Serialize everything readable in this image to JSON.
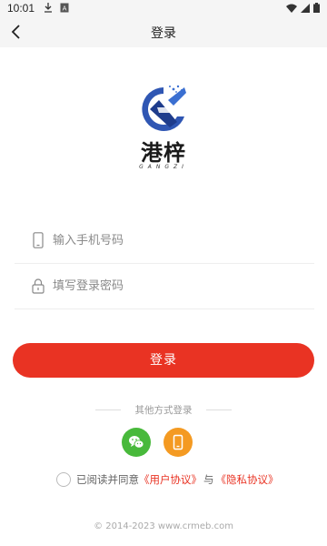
{
  "status_bar": {
    "time": "10:01",
    "left_icons": [
      "download-icon",
      "a-box-icon"
    ],
    "right_icons": [
      "wifi-icon",
      "signal-icon",
      "battery-icon"
    ]
  },
  "nav": {
    "title": "登录",
    "back_icon": "chevron-left-icon"
  },
  "logo": {
    "brand_cn": "港梓",
    "brand_en": "GANGZI"
  },
  "form": {
    "phone_placeholder": "输入手机号码",
    "password_placeholder": "填写登录密码",
    "phone_icon": "mobile-phone-icon",
    "password_icon": "lock-icon"
  },
  "login_button": "登录",
  "other_login": {
    "label": "其他方式登录",
    "options": [
      "wechat-icon",
      "phone-login-icon"
    ]
  },
  "agreement": {
    "prefix": "已阅读并同意",
    "user_agreement": "《用户协议》",
    "and": "与",
    "privacy_policy": "《隐私协议》"
  },
  "footer": "© 2014-2023  www.crmeb.com",
  "colors": {
    "primary": "#e93323",
    "wechat": "#48b93b",
    "phone_login": "#f49a22",
    "logo_blue": "#2f56b3"
  }
}
